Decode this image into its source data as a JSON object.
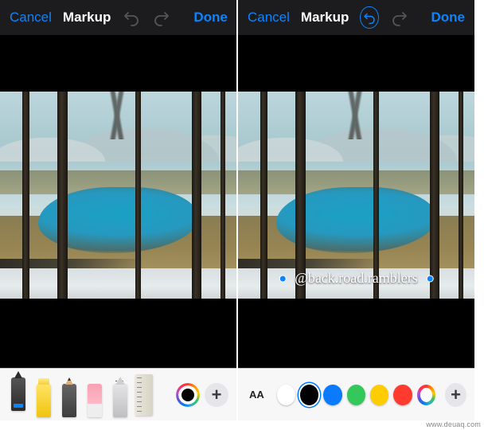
{
  "left": {
    "topbar": {
      "cancel": "Cancel",
      "title": "Markup",
      "done": "Done",
      "undo_enabled": false,
      "redo_enabled": false
    },
    "toolbar": {
      "tools": [
        {
          "name": "pen",
          "selected": true
        },
        {
          "name": "marker",
          "selected": false
        },
        {
          "name": "pencil",
          "selected": false
        },
        {
          "name": "eraser",
          "selected": false
        },
        {
          "name": "lasso",
          "selected": false
        },
        {
          "name": "ruler",
          "selected": false
        }
      ],
      "current_color": "#000000"
    }
  },
  "right": {
    "topbar": {
      "cancel": "Cancel",
      "title": "Markup",
      "done": "Done",
      "undo_enabled": true,
      "redo_enabled": false
    },
    "watermark": "@back.road.ramblers",
    "toolbar": {
      "font_size_label": "AA",
      "colors": [
        {
          "name": "white",
          "hex": "#ffffff",
          "selected": false
        },
        {
          "name": "black",
          "hex": "#000000",
          "selected": true
        },
        {
          "name": "blue",
          "hex": "#0a7aff",
          "selected": false
        },
        {
          "name": "green",
          "hex": "#34c759",
          "selected": false
        },
        {
          "name": "yellow",
          "hex": "#ffcc00",
          "selected": false
        },
        {
          "name": "red",
          "hex": "#ff3b30",
          "selected": false
        }
      ]
    }
  },
  "source": "www.deuaq.com"
}
